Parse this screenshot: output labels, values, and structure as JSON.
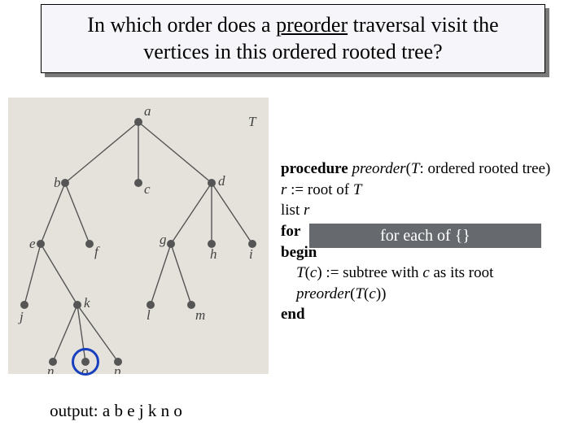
{
  "title": {
    "pre": "In which order does a ",
    "underlined": "preorder",
    "post": " traversal visit the vertices in this ordered rooted tree?"
  },
  "tree": {
    "labelT": "T",
    "nodes": {
      "a": "a",
      "b": "b",
      "c": "c",
      "d": "d",
      "e": "e",
      "f": "f",
      "g": "g",
      "h": "h",
      "i": "i",
      "j": "j",
      "k": "k",
      "l": "l",
      "m": "m",
      "n": "n",
      "o": "o",
      "p": "p"
    }
  },
  "algo": {
    "l1a": "procedure ",
    "l1b": "preorder",
    "l1c": "(",
    "l1d": "T",
    "l1e": ": ordered rooted tree)",
    "l2a": "r",
    "l2b": " := root of ",
    "l2c": "T",
    "l3a": "list ",
    "l3b": "r",
    "l4": "for",
    "l5": "begin",
    "l6a": "    T",
    "l6b": "(",
    "l6c": "c",
    "l6d": ") := subtree with ",
    "l6e": "c",
    "l6f": " as its root",
    "l7a": "    preorder",
    "l7b": "(",
    "l7c": "T",
    "l7d": "(",
    "l7e": "c",
    "l7f": "))",
    "l8": "end"
  },
  "overlay_text": "for each of {}",
  "output_text": "output: a b e j k n o"
}
